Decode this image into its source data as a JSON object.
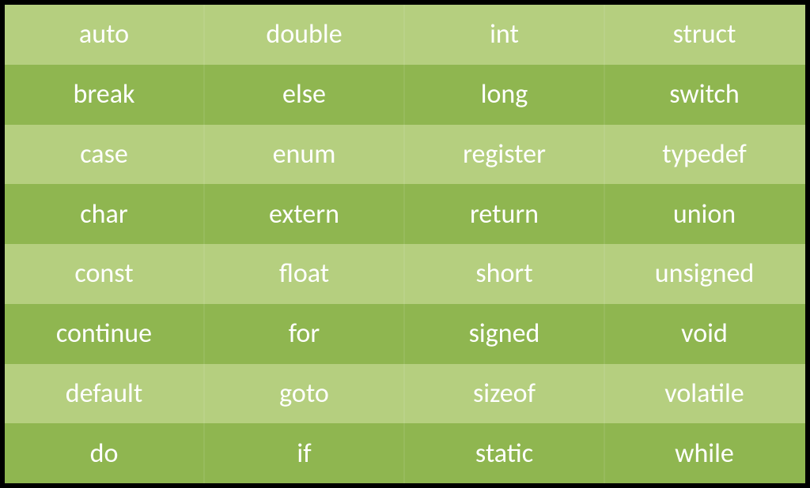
{
  "table": {
    "rows": [
      {
        "cells": [
          "auto",
          "double",
          "int",
          "struct"
        ]
      },
      {
        "cells": [
          "break",
          "else",
          "long",
          "switch"
        ]
      },
      {
        "cells": [
          "case",
          "enum",
          "register",
          "typedef"
        ]
      },
      {
        "cells": [
          "char",
          "extern",
          "return",
          "union"
        ]
      },
      {
        "cells": [
          "const",
          "float",
          "short",
          "unsigned"
        ]
      },
      {
        "cells": [
          "continue",
          "for",
          "signed",
          "void"
        ]
      },
      {
        "cells": [
          "default",
          "goto",
          "sizeof",
          "volatile"
        ]
      },
      {
        "cells": [
          "do",
          "if",
          "static",
          "while"
        ]
      }
    ]
  },
  "colors": {
    "light_row": "#b5cf7f",
    "dark_row": "#8fb650",
    "text": "#ffffff",
    "border": "#000000"
  }
}
